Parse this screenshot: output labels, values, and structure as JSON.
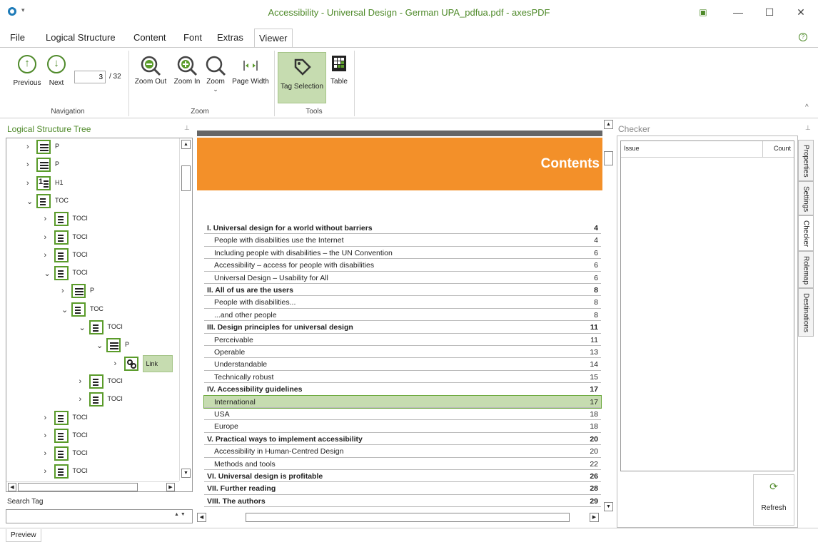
{
  "window": {
    "title": "Accessibility - Universal Design - German UPA_pdfua.pdf - axesPDF",
    "controls": [
      "restore-down",
      "minimize",
      "maximize",
      "close"
    ]
  },
  "menu": {
    "tabs": [
      {
        "label": "File"
      },
      {
        "label": "Logical Structure"
      },
      {
        "label": "Content"
      },
      {
        "label": "Font"
      },
      {
        "label": "Extras"
      },
      {
        "label": "Viewer"
      }
    ],
    "active": "Viewer"
  },
  "ribbon": {
    "navigation": {
      "previous_label": "Previous",
      "next_label": "Next",
      "page_value": "3",
      "page_total": "/ 32",
      "group_label": "Navigation"
    },
    "zoom": {
      "zoom_out_label": "Zoom Out",
      "zoom_in_label": "Zoom In",
      "zoom_label": "Zoom",
      "page_width_label": "Page Width",
      "group_label": "Zoom"
    },
    "tools": {
      "tag_selection_label": "Tag Selection",
      "table_label": "Table",
      "group_label": "Tools"
    }
  },
  "left_pane": {
    "title": "Logical Structure Tree",
    "tree": [
      {
        "label": "P",
        "level": 0,
        "expanded": false,
        "icon": "paragraph-icon"
      },
      {
        "label": "P",
        "level": 0,
        "expanded": false,
        "icon": "paragraph-icon"
      },
      {
        "label": "H1",
        "level": 0,
        "expanded": false,
        "icon": "heading-icon"
      },
      {
        "label": "TOC",
        "level": 0,
        "expanded": true,
        "icon": "toc-icon"
      },
      {
        "label": "TOCI",
        "level": 1,
        "expanded": false,
        "icon": "toc-item-icon"
      },
      {
        "label": "TOCI",
        "level": 1,
        "expanded": false,
        "icon": "toc-item-icon"
      },
      {
        "label": "TOCI",
        "level": 1,
        "expanded": false,
        "icon": "toc-item-icon"
      },
      {
        "label": "TOCI",
        "level": 1,
        "expanded": true,
        "icon": "toc-item-icon"
      },
      {
        "label": "P",
        "level": 2,
        "expanded": false,
        "icon": "paragraph-icon"
      },
      {
        "label": "TOC",
        "level": 2,
        "expanded": true,
        "icon": "toc-icon"
      },
      {
        "label": "TOCI",
        "level": 3,
        "expanded": true,
        "icon": "toc-item-icon"
      },
      {
        "label": "P",
        "level": 4,
        "expanded": true,
        "icon": "paragraph-icon"
      },
      {
        "label": "Link",
        "level": 5,
        "expanded": false,
        "icon": "link-icon",
        "selected": true
      },
      {
        "label": "TOCI",
        "level": 3,
        "expanded": false,
        "icon": "toc-item-icon"
      },
      {
        "label": "TOCI",
        "level": 3,
        "expanded": false,
        "icon": "toc-item-icon"
      },
      {
        "label": "TOCI",
        "level": 1,
        "expanded": false,
        "icon": "toc-item-icon"
      },
      {
        "label": "TOCI",
        "level": 1,
        "expanded": false,
        "icon": "toc-item-icon"
      },
      {
        "label": "TOCI",
        "level": 1,
        "expanded": false,
        "icon": "toc-item-icon"
      },
      {
        "label": "TOCI",
        "level": 1,
        "expanded": false,
        "icon": "toc-item-icon"
      }
    ],
    "search_label": "Search Tag",
    "search_value": ""
  },
  "document": {
    "heading": "Contents",
    "entries": [
      {
        "text": "I. Universal design for a world without barriers",
        "page": "4",
        "bold": true
      },
      {
        "text": "People with disabilities use the Internet",
        "page": "4"
      },
      {
        "text": "Including people with disabilities – the UN Convention",
        "page": "6"
      },
      {
        "text": "Accessibility – access for people with disabilities",
        "page": "6"
      },
      {
        "text": "Universal Design – Usability for All",
        "page": "6"
      },
      {
        "text": "II. All of us are the users",
        "page": "8",
        "bold": true
      },
      {
        "text": "People with disabilities...",
        "page": "8"
      },
      {
        "text": "...and other people",
        "page": "8"
      },
      {
        "text": "III. Design principles for universal design",
        "page": "11",
        "bold": true
      },
      {
        "text": "Perceivable",
        "page": "11"
      },
      {
        "text": "Operable",
        "page": "13"
      },
      {
        "text": "Understandable",
        "page": "14"
      },
      {
        "text": "Technically robust",
        "page": "15"
      },
      {
        "text": "IV. Accessibility guidelines",
        "page": "17",
        "bold": true
      },
      {
        "text": "International",
        "page": "17",
        "highlighted": true
      },
      {
        "text": "USA",
        "page": "18"
      },
      {
        "text": "Europe",
        "page": "18"
      },
      {
        "text": "V. Practical ways to implement accessibility",
        "page": "20",
        "bold": true
      },
      {
        "text": "Accessibility in Human-Centred Design",
        "page": "20"
      },
      {
        "text": "Methods and tools",
        "page": "22"
      },
      {
        "text": "VI. Universal design is profitable",
        "page": "26",
        "bold": true
      },
      {
        "text": "VII. Further reading",
        "page": "28",
        "bold": true
      },
      {
        "text": "VIII. The authors",
        "page": "29",
        "bold": true
      }
    ]
  },
  "checker": {
    "title": "Checker",
    "col_issue": "Issue",
    "col_count": "Count",
    "refresh_label": "Refresh"
  },
  "side_tabs": [
    "Properties",
    "Settings",
    "Checker",
    "Rolemap",
    "Destinations"
  ],
  "bottom_tab": "Preview",
  "colors": {
    "accent": "#4f8a2a",
    "orange": "#f39029",
    "selected_bg": "#c6dcb0"
  }
}
